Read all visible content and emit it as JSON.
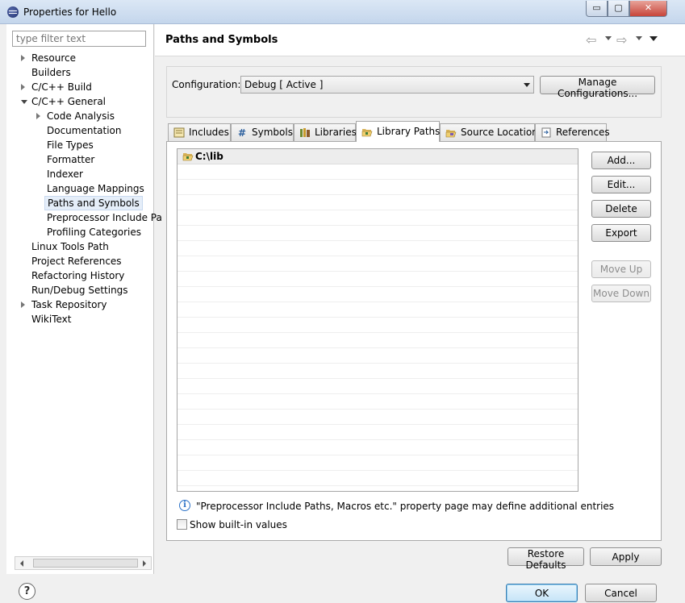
{
  "window": {
    "title": "Properties for Hello",
    "minimize_glyph": "▭",
    "maximize_glyph": "▢",
    "close_glyph": "✕"
  },
  "sidebar": {
    "filter_placeholder": "type filter text",
    "items": [
      {
        "label": "Resource",
        "level": 0,
        "toggle": "collapsed"
      },
      {
        "label": "Builders",
        "level": 0,
        "toggle": "none"
      },
      {
        "label": "C/C++ Build",
        "level": 0,
        "toggle": "collapsed"
      },
      {
        "label": "C/C++ General",
        "level": 0,
        "toggle": "expanded"
      },
      {
        "label": "Code Analysis",
        "level": 1,
        "toggle": "collapsed"
      },
      {
        "label": "Documentation",
        "level": 1,
        "toggle": "none"
      },
      {
        "label": "File Types",
        "level": 1,
        "toggle": "none"
      },
      {
        "label": "Formatter",
        "level": 1,
        "toggle": "none"
      },
      {
        "label": "Indexer",
        "level": 1,
        "toggle": "none"
      },
      {
        "label": "Language Mappings",
        "level": 1,
        "toggle": "none"
      },
      {
        "label": "Paths and Symbols",
        "level": 1,
        "toggle": "none",
        "selected": true
      },
      {
        "label": "Preprocessor Include Pa",
        "level": 1,
        "toggle": "none"
      },
      {
        "label": "Profiling Categories",
        "level": 1,
        "toggle": "none"
      },
      {
        "label": "Linux Tools Path",
        "level": 0,
        "toggle": "none"
      },
      {
        "label": "Project References",
        "level": 0,
        "toggle": "none"
      },
      {
        "label": "Refactoring History",
        "level": 0,
        "toggle": "none"
      },
      {
        "label": "Run/Debug Settings",
        "level": 0,
        "toggle": "none"
      },
      {
        "label": "Task Repository",
        "level": 0,
        "toggle": "collapsed"
      },
      {
        "label": "WikiText",
        "level": 0,
        "toggle": "none"
      }
    ]
  },
  "page": {
    "title": "Paths and Symbols",
    "back_glyph": "⇦",
    "forward_glyph": "⇨",
    "configuration_label": "Configuration:",
    "configuration_value": "Debug  [ Active ]",
    "manage_configurations_label": "Manage Configurations...",
    "tabs": [
      {
        "label": "Includes",
        "icon": "includes-icon"
      },
      {
        "label": "Symbols",
        "icon": "hash-icon"
      },
      {
        "label": "Libraries",
        "icon": "libraries-icon"
      },
      {
        "label": "Library Paths",
        "icon": "folder-open-icon",
        "active": true
      },
      {
        "label": "Source Location",
        "icon": "source-folder-icon"
      },
      {
        "label": "References",
        "icon": "references-icon"
      }
    ],
    "library_paths": [
      "C:\\lib"
    ],
    "buttons": {
      "add": "Add...",
      "edit": "Edit...",
      "delete": "Delete",
      "export": "Export",
      "move_up": "Move Up",
      "move_down": "Move Down"
    },
    "info_glyph": "i",
    "info_text": "\"Preprocessor Include Paths, Macros etc.\" property page may define additional entries",
    "show_builtin_label": "Show built-in values",
    "restore_defaults_label": "Restore Defaults",
    "apply_label": "Apply"
  },
  "footer": {
    "help_glyph": "?",
    "ok_label": "OK",
    "cancel_label": "Cancel"
  }
}
